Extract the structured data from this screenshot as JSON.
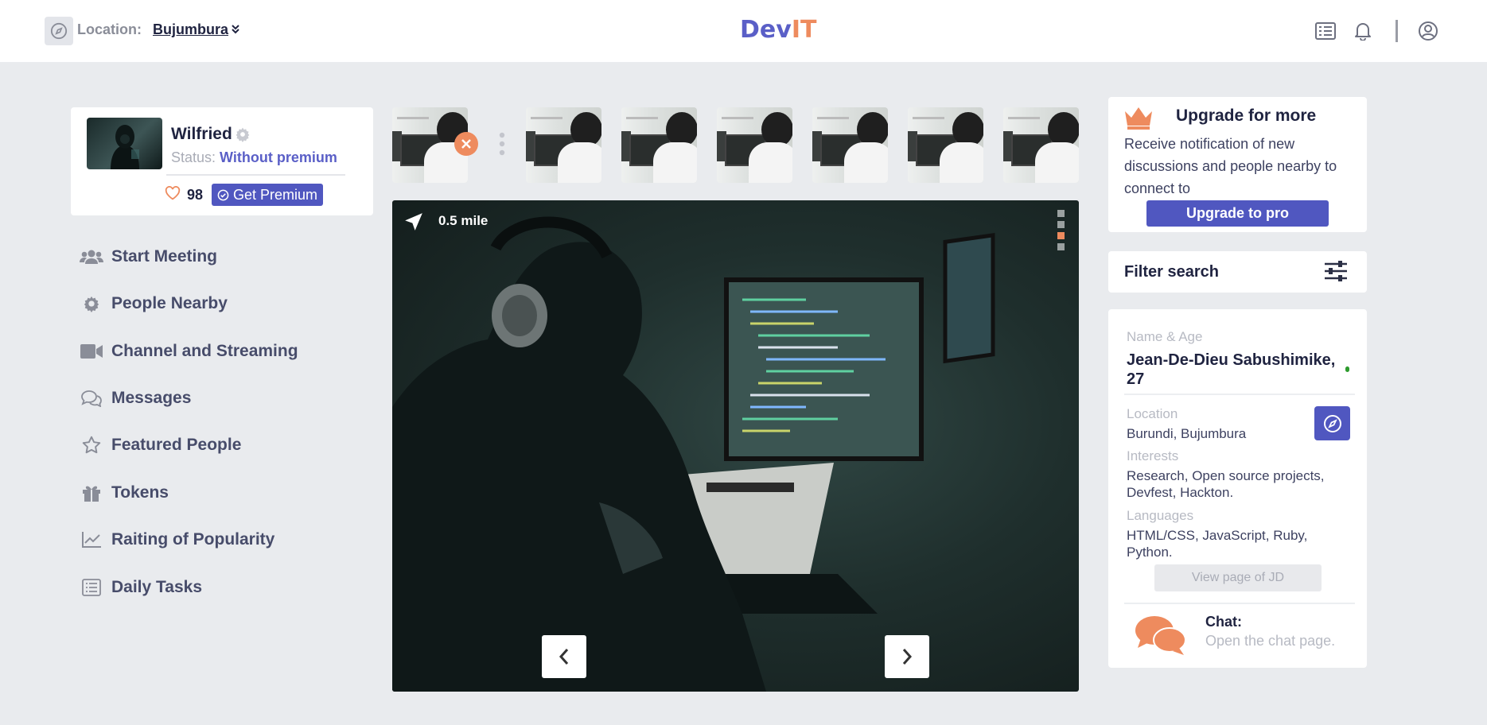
{
  "header": {
    "location_label": "Location:",
    "location_value": "Bujumbura",
    "logo_part1": "Dev",
    "logo_part2": "IT"
  },
  "profile": {
    "name": "Wilfried",
    "status_label": "Status:",
    "status_value": "Without premium",
    "likes": "98",
    "premium_button": "Get Premium"
  },
  "menu": [
    {
      "label": "Start Meeting",
      "icon": "users-icon"
    },
    {
      "label": "People Nearby",
      "icon": "gear-icon"
    },
    {
      "label": "Channel and Streaming",
      "icon": "video-camera-icon"
    },
    {
      "label": "Messages",
      "icon": "chat-bubbles-icon"
    },
    {
      "label": "Featured People",
      "icon": "star-icon"
    },
    {
      "label": "Tokens",
      "icon": "gift-icon"
    },
    {
      "label": "Raiting of Popularity",
      "icon": "line-chart-icon"
    },
    {
      "label": "Daily Tasks",
      "icon": "list-icon"
    }
  ],
  "photo": {
    "distance": "0.5 mile"
  },
  "upgrade": {
    "title": "Upgrade for more",
    "text": "Receive notification of new discussions and people nearby to connect to",
    "button": "Upgrade to pro"
  },
  "filter": {
    "title": "Filter search"
  },
  "person": {
    "name_label": "Name & Age",
    "name_value": "Jean-De-Dieu Sabushimike, 27",
    "location_label": "Location",
    "location_value": "Burundi, Bujumbura",
    "interests_label": "Interests",
    "interests_value": "Research, Open source projects, Devfest, Hackton.",
    "languages_label": "Languages",
    "languages_value": "HTML/CSS, JavaScript, Ruby, Python.",
    "view_button": "View page of JD"
  },
  "chat": {
    "title": "Chat:",
    "subtitle": "Open the chat page."
  },
  "colors": {
    "accent": "#5057c0",
    "orange": "#ee8b5e",
    "background": "#e9ebee"
  }
}
